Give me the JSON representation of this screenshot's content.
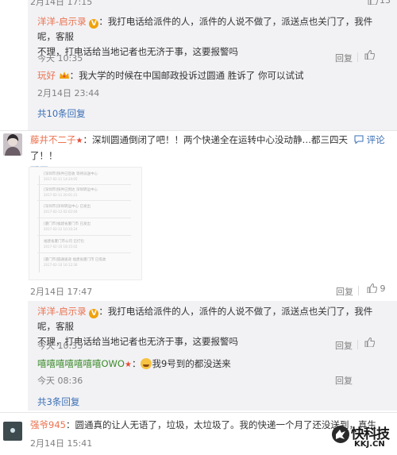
{
  "top_strip": {
    "date": "2月14日 17:15",
    "like_count": "13"
  },
  "reply_box_1": {
    "replies": [
      {
        "user": "洋洋-启示录",
        "text_line1": "：我打电话给派件的人，派件的人说不做了，派送点也关门了，我件呢，客服",
        "text_line2": "不理，打电话给当地记者也无济于事，这要报警吗",
        "time": "今天 10:35",
        "reply_label": "回复"
      },
      {
        "user": "玩好",
        "text": "：我大学的时候在中国邮政投诉过圆通 胜诉了 你可以试试",
        "time": "2月14日 23:44"
      }
    ],
    "more_replies": "共10条回复"
  },
  "main_comment": {
    "user": "藤井不二子",
    "text_line1": "：深圳圆通倒闭了吧！！两个快递全在运转中心没动静…都三四天了！！",
    "text_line2": "配图",
    "comment_label": "评论",
    "date": "2月14日 17:47",
    "reply_label": "回复",
    "like_count": "9",
    "picture_rows": [
      {
        "line1": "[深圳市]快件已签收 等待派送中心",
        "line2": "2017-02-11 14:24:05"
      },
      {
        "line1": "[深圳市]快件已到达 深圳转运中心",
        "line2": "2017-02-11 20:01:21"
      },
      {
        "line1": "[深圳市]深圳转运中心 已发出",
        "line2": "2017-02-12 02:02:04"
      },
      {
        "line1": "[厦门市]福建省厦门市 已发出",
        "line2": "2017-02-12 10:10:24"
      },
      {
        "line1": "福建省厦门市公司 已打包",
        "line2": "2017-02-10 18:15:02"
      },
      {
        "line1": "[厦门市]圆通速递 福建省厦门市 已揽收",
        "line2": "2017-02-10 16:12:36"
      }
    ]
  },
  "reply_box_2": {
    "replies": [
      {
        "user": "洋洋-启示录",
        "text_line1": "：我打电话给派件的人，派件的人说不做了，派送点也关门了，我件呢，客服",
        "text_line2": "不理，打电话给当地记者也无济于事，这要报警吗",
        "time": "今天 10:35",
        "reply_label": "回复"
      },
      {
        "user": "嘻嘻嘻嘻嘻嘻嘻OWO",
        "text": "我9号到的都没送来",
        "time": "今天 08:36",
        "reply_label": "回复"
      }
    ],
    "more_replies": "共3条回复"
  },
  "bottom_comment": {
    "user": "强爷945",
    "text": "：圆通真的让人无语了，垃圾，太垃圾了。我的快递一个月了还没送到，真生",
    "date": "2月14日 15:41"
  },
  "watermark": {
    "title": "快科技",
    "sub": "KKJ.CN"
  },
  "colors": {
    "link": "#3a6fb4",
    "username": "#eb7350",
    "meta": "#808080",
    "reply_bg": "#f2f2f5"
  }
}
